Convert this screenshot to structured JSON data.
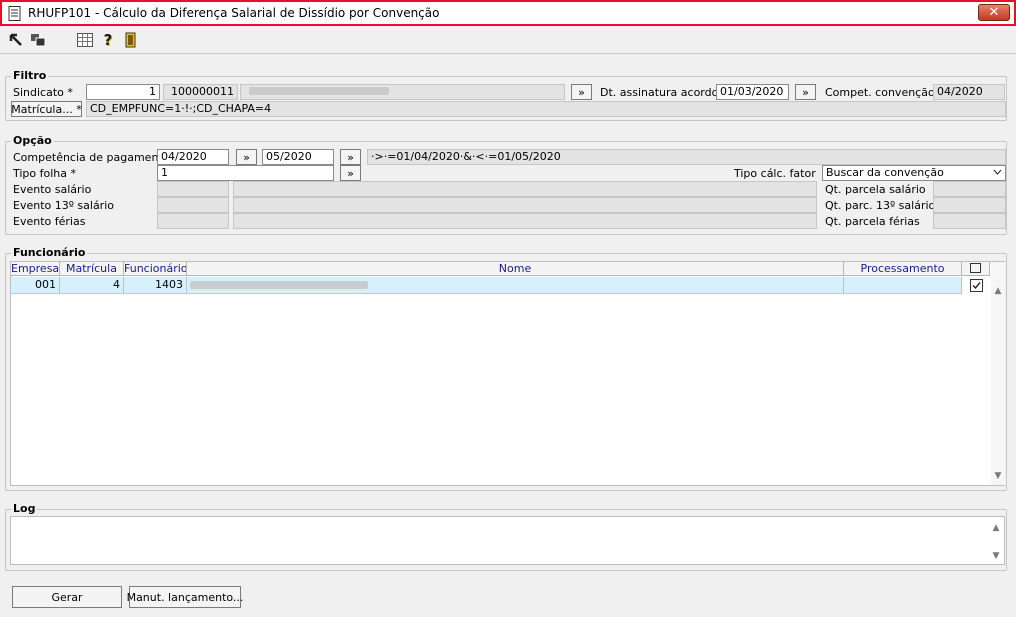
{
  "window": {
    "title": "RHUFP101 - Cálculo da Diferença Salarial de Dissídio por Convenção",
    "close_label": "✕"
  },
  "filtro": {
    "title": "Filtro",
    "sindicato_label": "Sindicato *",
    "sindicato_value": "1",
    "sindicato_code": "100000011",
    "dt_assinatura_label": "Dt. assinatura acordo *",
    "dt_assinatura_value": "01/03/2020",
    "compet_convencao_label": "Compet. convenção *",
    "compet_convencao_value": "04/2020",
    "matricula_button": "Matrícula... *",
    "matricula_filter": "CD_EMPFUNC=1·!·;CD_CHAPA=4",
    "lookup_label": "»"
  },
  "opcao": {
    "title": "Opção",
    "competencia_label": "Competência de pagamento *",
    "competencia_de": "04/2020",
    "competencia_ate": "05/2020",
    "competencia_expr": "·>·=01/04/2020·&·<·=01/05/2020",
    "tipo_folha_label": "Tipo folha *",
    "tipo_folha_value": "1",
    "tipo_calc_label": "Tipo cálc. fator",
    "tipo_calc_value": "Buscar da convenção",
    "evento_salario_label": "Evento salário",
    "evento_13_label": "Evento 13º salário",
    "evento_ferias_label": "Evento férias",
    "qt_parcela_salario_label": "Qt. parcela salário",
    "qt_parc_13_label": "Qt. parc. 13º salário",
    "qt_parcela_ferias_label": "Qt. parcela férias",
    "lookup_label": "»"
  },
  "funcionario": {
    "title": "Funcionário",
    "columns": [
      "Empresa",
      "Matrícula",
      "Funcionário",
      "Nome",
      "Processamento"
    ],
    "rows": [
      {
        "empresa": "001",
        "matricula": "4",
        "funcionario": "1403",
        "processamento": ""
      }
    ]
  },
  "log": {
    "title": "Log"
  },
  "buttons": {
    "gerar": "Gerar",
    "manut": "Manut. lançamento..."
  },
  "colors": {
    "accent_border": "#e81123",
    "selected_row": "#d6f1fb",
    "header_text": "#1a1a8c"
  }
}
